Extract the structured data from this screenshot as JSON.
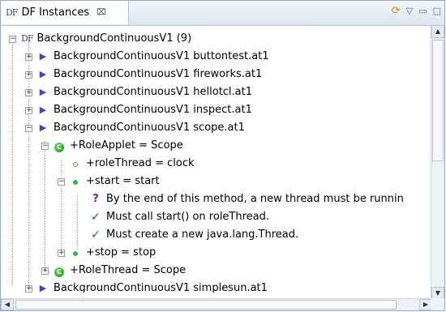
{
  "view": {
    "tab_icon": "DF",
    "tab_title": "DF Instances",
    "tab_close": "⌧",
    "toolbar": [
      "sync-icon",
      "view-menu-icon",
      "minimize-icon",
      "maximize-icon"
    ]
  },
  "tree": {
    "root": {
      "icon": "DF",
      "label": "BackgroundContinuousV1 (9)"
    },
    "items": [
      {
        "label": "BackgroundContinuousV1 buttontest.at1"
      },
      {
        "label": "BackgroundContinuousV1 fireworks.at1"
      },
      {
        "label": "BackgroundContinuousV1 hellotcl.at1"
      },
      {
        "label": "BackgroundContinuousV1 inspect.at1"
      },
      {
        "label": "BackgroundContinuousV1 scope.at1"
      },
      {
        "label": "+RoleApplet = Scope"
      },
      {
        "label": "+roleThread = clock"
      },
      {
        "label": "+start = start"
      },
      {
        "label": "By the end of this method, a new thread must be runnin"
      },
      {
        "label": "Must call start() on roleThread."
      },
      {
        "label": "Must create a new java.lang.Thread."
      },
      {
        "label": "+stop = stop"
      },
      {
        "label": "+RoleThread = Scope"
      },
      {
        "label": "BackgroundContinuousV1 simplesun.at1"
      }
    ]
  },
  "colors": {
    "accent": "#3c46c8",
    "green": "#2e9e2a",
    "question": "#7a1fa2",
    "check": "#1f4fb3"
  }
}
